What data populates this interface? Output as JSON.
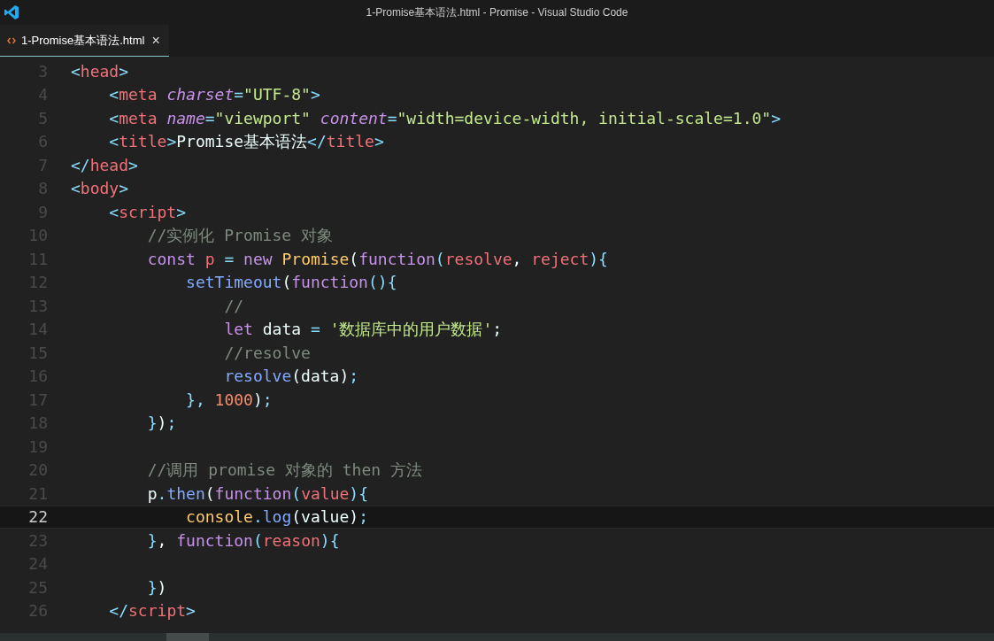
{
  "window": {
    "title": "1-Promise基本语法.html - Promise - Visual Studio Code"
  },
  "tabs": [
    {
      "label": "1-Promise基本语法.html",
      "close": "×",
      "selected": true
    }
  ],
  "lines": [
    {
      "number": "3",
      "current": false,
      "tokens": [
        {
          "kind": "punct",
          "text": "<"
        },
        {
          "kind": "tag",
          "text": "head"
        },
        {
          "kind": "punct",
          "text": ">"
        }
      ]
    },
    {
      "number": "4",
      "current": false,
      "tokens": [
        {
          "kind": "punct",
          "text": "    <"
        },
        {
          "kind": "tag",
          "text": "meta"
        },
        {
          "kind": "attr",
          "text": " charset"
        },
        {
          "kind": "punct",
          "text": "="
        },
        {
          "kind": "string",
          "text": "\"UTF-8\""
        },
        {
          "kind": "punct",
          "text": ">"
        }
      ]
    },
    {
      "number": "5",
      "current": false,
      "tokens": [
        {
          "kind": "punct",
          "text": "    <"
        },
        {
          "kind": "tag",
          "text": "meta"
        },
        {
          "kind": "attr",
          "text": " name"
        },
        {
          "kind": "punct",
          "text": "="
        },
        {
          "kind": "string",
          "text": "\"viewport\""
        },
        {
          "kind": "attr",
          "text": " content"
        },
        {
          "kind": "punct",
          "text": "="
        },
        {
          "kind": "string",
          "text": "\"width=device-width, initial-scale=1.0\""
        },
        {
          "kind": "punct",
          "text": ">"
        }
      ]
    },
    {
      "number": "6",
      "current": false,
      "tokens": [
        {
          "kind": "punct",
          "text": "    <"
        },
        {
          "kind": "tag",
          "text": "title"
        },
        {
          "kind": "punct",
          "text": ">"
        },
        {
          "kind": "plain",
          "text": "Promise基本语法"
        },
        {
          "kind": "punct",
          "text": "</"
        },
        {
          "kind": "tag",
          "text": "title"
        },
        {
          "kind": "punct",
          "text": ">"
        }
      ]
    },
    {
      "number": "7",
      "current": false,
      "tokens": [
        {
          "kind": "punct",
          "text": "</"
        },
        {
          "kind": "tag",
          "text": "head"
        },
        {
          "kind": "punct",
          "text": ">"
        }
      ]
    },
    {
      "number": "8",
      "current": false,
      "tokens": [
        {
          "kind": "punct",
          "text": "<"
        },
        {
          "kind": "tag",
          "text": "body"
        },
        {
          "kind": "punct",
          "text": ">"
        }
      ]
    },
    {
      "number": "9",
      "current": false,
      "tokens": [
        {
          "kind": "punct",
          "text": "    <"
        },
        {
          "kind": "tag",
          "text": "script"
        },
        {
          "kind": "punct",
          "text": ">"
        }
      ]
    },
    {
      "number": "10",
      "current": false,
      "tokens": [
        {
          "kind": "comment",
          "text": "        //实例化 Promise 对象"
        }
      ]
    },
    {
      "number": "11",
      "current": false,
      "tokens": [
        {
          "kind": "keyword",
          "text": "        const "
        },
        {
          "kind": "variable",
          "text": "p "
        },
        {
          "kind": "punct",
          "text": "= "
        },
        {
          "kind": "keyword",
          "text": "new "
        },
        {
          "kind": "class",
          "text": "Promise"
        },
        {
          "kind": "plain",
          "text": "("
        },
        {
          "kind": "keyword",
          "text": "function"
        },
        {
          "kind": "punct",
          "text": "("
        },
        {
          "kind": "param",
          "text": "resolve"
        },
        {
          "kind": "plain",
          "text": ", "
        },
        {
          "kind": "param",
          "text": "reject"
        },
        {
          "kind": "punct",
          "text": "){"
        }
      ]
    },
    {
      "number": "12",
      "current": false,
      "tokens": [
        {
          "kind": "function",
          "text": "            setTimeout"
        },
        {
          "kind": "plain",
          "text": "("
        },
        {
          "kind": "keyword",
          "text": "function"
        },
        {
          "kind": "punct",
          "text": "(){"
        }
      ]
    },
    {
      "number": "13",
      "current": false,
      "tokens": [
        {
          "kind": "comment",
          "text": "                //"
        }
      ]
    },
    {
      "number": "14",
      "current": false,
      "tokens": [
        {
          "kind": "keyword",
          "text": "                let "
        },
        {
          "kind": "plain",
          "text": "data "
        },
        {
          "kind": "punct",
          "text": "= "
        },
        {
          "kind": "string",
          "text": "'数据库中的用户数据'"
        },
        {
          "kind": "plain",
          "text": ";"
        }
      ]
    },
    {
      "number": "15",
      "current": false,
      "tokens": [
        {
          "kind": "comment",
          "text": "                //resolve"
        }
      ]
    },
    {
      "number": "16",
      "current": false,
      "tokens": [
        {
          "kind": "function",
          "text": "                resolve"
        },
        {
          "kind": "plain",
          "text": "(data)"
        },
        {
          "kind": "punct",
          "text": ";"
        }
      ]
    },
    {
      "number": "17",
      "current": false,
      "tokens": [
        {
          "kind": "punct",
          "text": "            }, "
        },
        {
          "kind": "number",
          "text": "1000"
        },
        {
          "kind": "plain",
          "text": ")"
        },
        {
          "kind": "punct",
          "text": ";"
        }
      ]
    },
    {
      "number": "18",
      "current": false,
      "tokens": [
        {
          "kind": "punct",
          "text": "        }"
        },
        {
          "kind": "plain",
          "text": ")"
        },
        {
          "kind": "punct",
          "text": ";"
        }
      ]
    },
    {
      "number": "19",
      "current": false
    },
    {
      "number": "20",
      "current": false,
      "tokens": [
        {
          "kind": "comment",
          "text": "        //调用 promise 对象的 then 方法"
        }
      ]
    },
    {
      "number": "21",
      "current": false,
      "tokens": [
        {
          "kind": "plain",
          "text": "        p"
        },
        {
          "kind": "punct",
          "text": "."
        },
        {
          "kind": "function",
          "text": "then"
        },
        {
          "kind": "plain",
          "text": "("
        },
        {
          "kind": "keyword",
          "text": "function"
        },
        {
          "kind": "punct",
          "text": "("
        },
        {
          "kind": "param",
          "text": "value"
        },
        {
          "kind": "punct",
          "text": "){"
        }
      ]
    },
    {
      "number": "22",
      "current": true,
      "tokens": [
        {
          "kind": "class",
          "text": "            console"
        },
        {
          "kind": "punct",
          "text": "."
        },
        {
          "kind": "function",
          "text": "log"
        },
        {
          "kind": "plain",
          "text": "(value)"
        },
        {
          "kind": "punct",
          "text": ";"
        }
      ]
    },
    {
      "number": "23",
      "current": false,
      "tokens": [
        {
          "kind": "punct",
          "text": "        }"
        },
        {
          "kind": "plain",
          "text": ", "
        },
        {
          "kind": "keyword",
          "text": "function"
        },
        {
          "kind": "punct",
          "text": "("
        },
        {
          "kind": "param",
          "text": "reason"
        },
        {
          "kind": "punct",
          "text": "){"
        }
      ]
    },
    {
      "number": "24",
      "current": false
    },
    {
      "number": "25",
      "current": false,
      "tokens": [
        {
          "kind": "punct",
          "text": "        }"
        },
        {
          "kind": "plain",
          "text": ")"
        }
      ]
    },
    {
      "number": "26",
      "current": false,
      "tokens": [
        {
          "kind": "punct",
          "text": "    </"
        },
        {
          "kind": "tag",
          "text": "script"
        },
        {
          "kind": "punct",
          "text": ">"
        }
      ]
    }
  ]
}
